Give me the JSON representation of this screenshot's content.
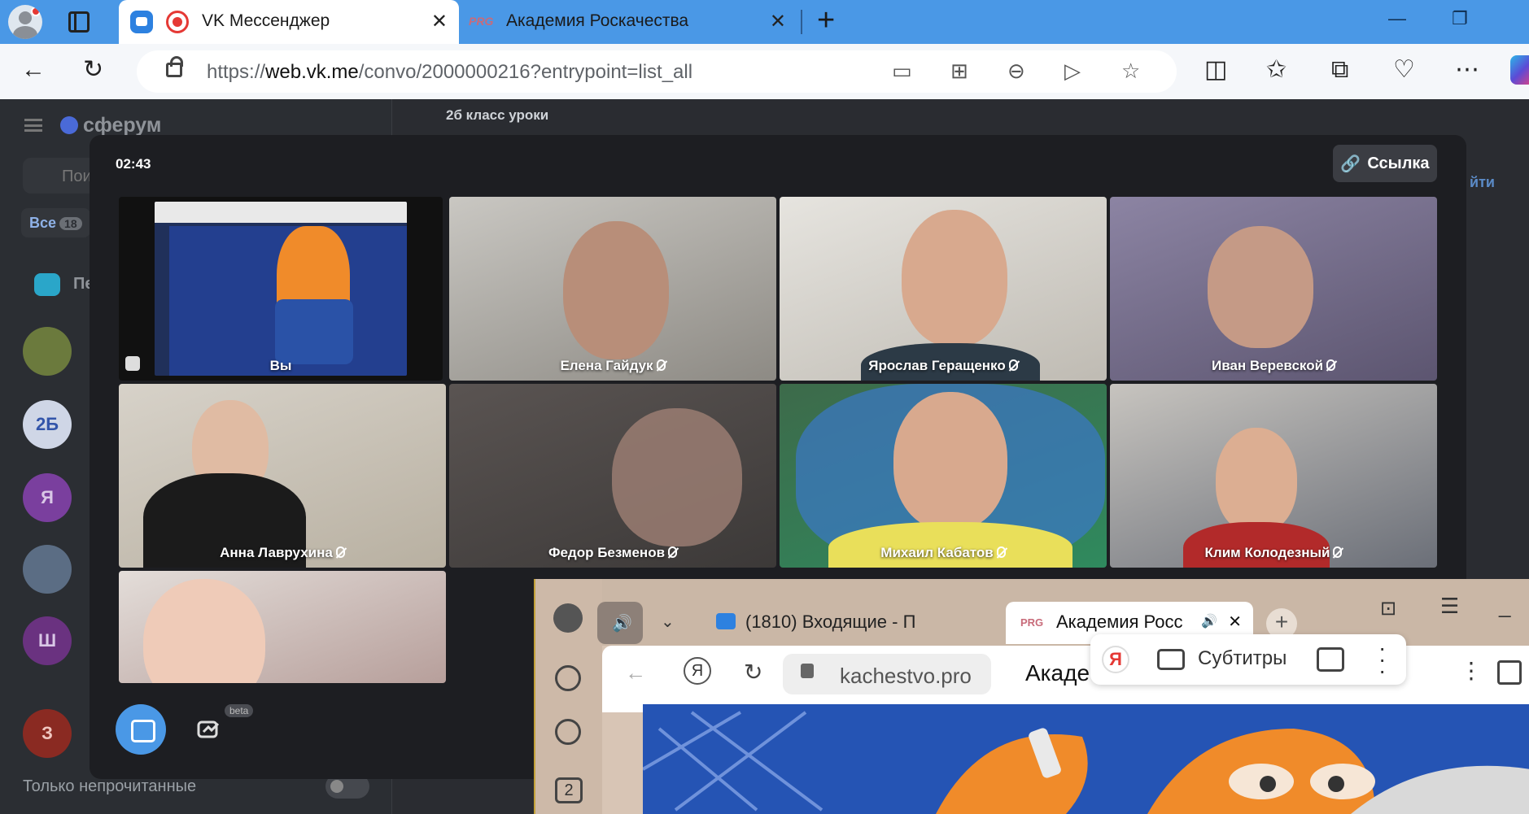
{
  "browser": {
    "tabs": [
      {
        "title": "VK Мессенджер",
        "close": "✕"
      },
      {
        "favicon_text": "PRG",
        "title": "Академия Роскачества",
        "close": "✕"
      }
    ],
    "new_tab": "+",
    "url_prefix": "https://",
    "url_host": "web.vk.me",
    "url_path": "/convo/2000000216?entrypoint=list_all"
  },
  "vk": {
    "brand": "сферум",
    "search_placeholder": "Пои",
    "filter_all": "Все",
    "filter_count": "18",
    "pinned_label": "Пе",
    "avatar_ya": "Я",
    "avatar_sh": "Ш",
    "avatar_z": "З",
    "avatar_2b": "2Б",
    "chat_title": "2б класс уроки",
    "unread_only": "Только непрочитанные",
    "join_partial": "йти"
  },
  "call": {
    "timer": "02:43",
    "link_label": "Ссылка",
    "participants": [
      {
        "name": "Вы"
      },
      {
        "name": "Елена Гайдук"
      },
      {
        "name": "Ярослав Геращенко"
      },
      {
        "name": "Иван Веревской"
      },
      {
        "name": "Анна Лаврухина"
      },
      {
        "name": "Федор Безменов"
      },
      {
        "name": "Михаил Кабатов"
      },
      {
        "name": "Клим Колодезный"
      }
    ],
    "beta": "beta"
  },
  "yandex": {
    "tab_mail": "(1810) Входящие - П",
    "tab_active_favicon": "PRG",
    "tab_active": "Академия Росс",
    "url": "kachestvo.pro",
    "page_title_partial": "Акаде",
    "ya_logo": "Я",
    "subtitles": "Субтитры",
    "sidebar_badge": "2"
  },
  "colors": {
    "tabbar": "#4a98e6",
    "vk_blue": "#4a98e6",
    "call_bg": "#1d1e22"
  }
}
